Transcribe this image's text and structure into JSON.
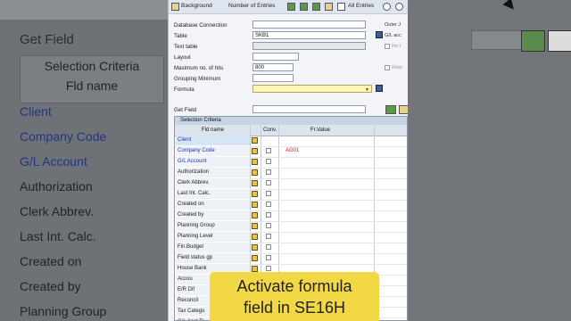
{
  "background": {
    "title": "Get Field",
    "header_line1": "Selection Criteria",
    "header_line2": "Fld name",
    "rows": [
      {
        "label": "Client",
        "blue": true
      },
      {
        "label": "Company Code",
        "blue": true
      },
      {
        "label": "G/L Account",
        "blue": true
      },
      {
        "label": "Authorization",
        "blue": false
      },
      {
        "label": "Clerk Abbrev.",
        "blue": false
      },
      {
        "label": "Last Int. Calc.",
        "blue": false
      },
      {
        "label": "Created on",
        "blue": false
      },
      {
        "label": "Created by",
        "blue": false
      },
      {
        "label": "Planning Group",
        "blue": false
      }
    ]
  },
  "toolbar": {
    "background_label": "Background",
    "entries_label": "Number of Entries",
    "all_entries_label": "All Entries"
  },
  "form": {
    "database_connection_label": "Database Connection",
    "table_label": "Table",
    "table_value": "SKB1",
    "text_table_label": "Text table",
    "layout_label": "Layout",
    "max_hits_label": "Maximum no. of hits",
    "max_hits_value": "800",
    "grouping_label": "Grouping Minimum",
    "formula_label": "Formula",
    "outer_join_label": "Outer J",
    "gl_acct_label": "G/L acc",
    "no_label": "No t",
    "main_label": "Main",
    "get_field_label": "Get Field"
  },
  "selection": {
    "title": "Selection Criteria",
    "col_fld": "Fld name",
    "col_conv": "Conv.",
    "col_frvalue": "Fr.Value",
    "rows": [
      {
        "label": "Client",
        "blue": true,
        "value": "",
        "highlight": true
      },
      {
        "label": "Company Code",
        "blue": true,
        "value": "AG01",
        "highlight": false
      },
      {
        "label": "G/L Account",
        "blue": true,
        "value": "",
        "highlight": false
      },
      {
        "label": "Authorization",
        "blue": false,
        "value": "",
        "highlight": false
      },
      {
        "label": "Clerk Abbrev.",
        "blue": false,
        "value": "",
        "highlight": false
      },
      {
        "label": "Last Int. Calc.",
        "blue": false,
        "value": "",
        "highlight": false
      },
      {
        "label": "Created on",
        "blue": false,
        "value": "",
        "highlight": false
      },
      {
        "label": "Created by",
        "blue": false,
        "value": "",
        "highlight": false
      },
      {
        "label": "Planning Group",
        "blue": false,
        "value": "",
        "highlight": false
      },
      {
        "label": "Planning Level",
        "blue": false,
        "value": "",
        "highlight": false
      },
      {
        "label": "Fin.Budget",
        "blue": false,
        "value": "",
        "highlight": false
      },
      {
        "label": "Field status gp",
        "blue": false,
        "value": "",
        "highlight": false
      },
      {
        "label": "House Bank",
        "blue": false,
        "value": "",
        "highlight": false
      },
      {
        "label": "Accou",
        "blue": false,
        "value": "",
        "highlight": false
      },
      {
        "label": "E/R Dif",
        "blue": false,
        "value": "",
        "highlight": false
      },
      {
        "label": "Reconcil",
        "blue": false,
        "value": "",
        "highlight": false
      },
      {
        "label": "Tax Catego",
        "blue": false,
        "value": "",
        "highlight": false
      },
      {
        "label": "G/L Acct Te",
        "blue": false,
        "value": "",
        "highlight": false
      }
    ]
  },
  "caption": {
    "line1": "Activate formula",
    "line2": "field in SE16H",
    "color": "#f3d845"
  }
}
